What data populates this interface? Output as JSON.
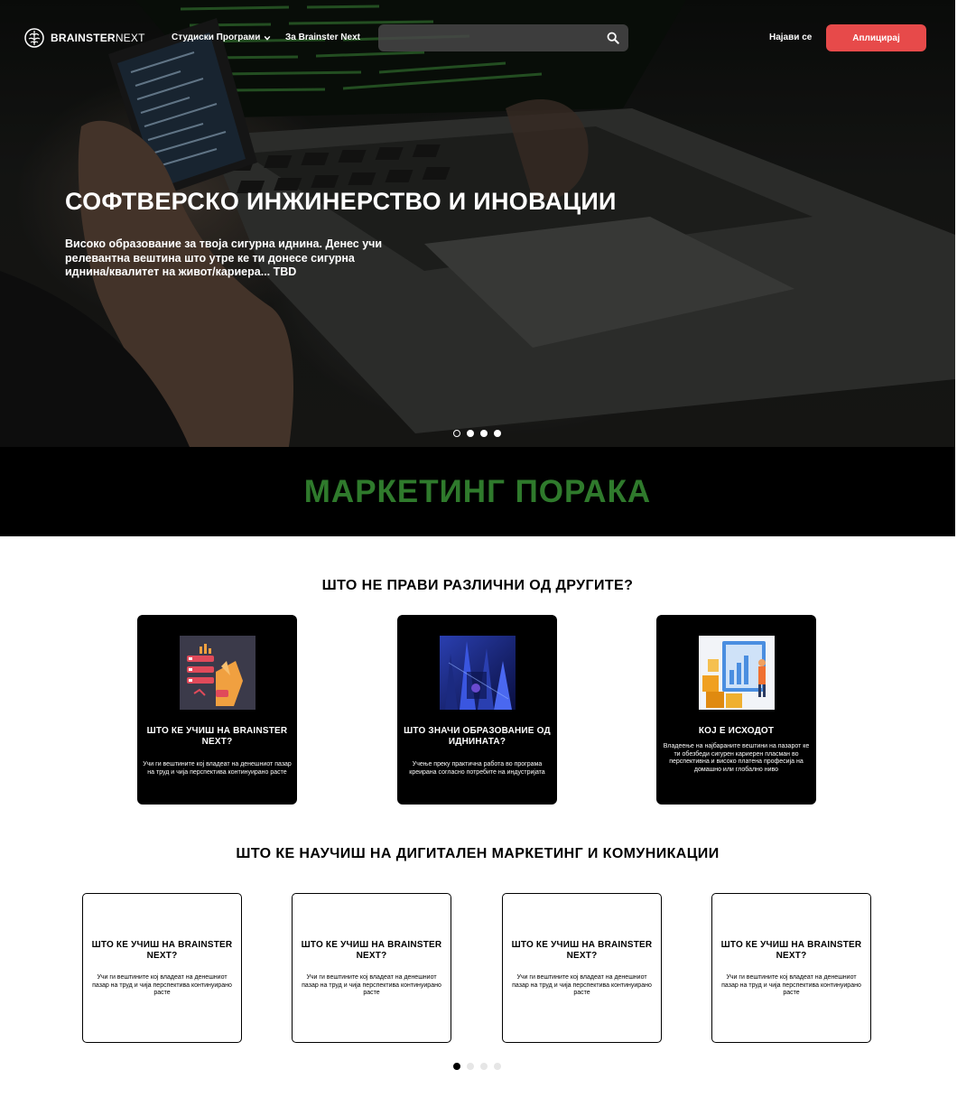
{
  "brand": {
    "name_bold": "BRAINSTER",
    "name_thin": "NEXT"
  },
  "nav": {
    "programs": "Студиски Програми",
    "about": "За Brainster Next",
    "search_placeholder": "",
    "login": "Најави се",
    "apply": "Аплицирај"
  },
  "hero": {
    "title": "СОФТВЕРСКО ИНЖИНЕРСТВО И ИНОВАЦИИ",
    "subtitle": "Високо образование за твоја сигурна иднина. Денес учи релевантна вештина што утре ке ти донесе сигурна иднина/квалитет на живот/кариера... TBD",
    "slides_total": 4,
    "active_slide": 1
  },
  "banner": {
    "text": "МАРКЕТИНГ ПОРАКА",
    "color": "#2f7a2c"
  },
  "differences": {
    "title": "ШТО НЕ ПРАВИ РАЗЛИЧНИ ОД ДРУГИТЕ?",
    "cards": [
      {
        "title": "ШТО КЕ УЧИШ НА BRAINSTER NEXT?",
        "text": "Учи ги вештините кој владеат на денешниот пазар на труд и чија перспектива континуирано расте",
        "icon": "learning-illustration"
      },
      {
        "title": "ШТО ЗНАЧИ ОБРАЗОВАНИЕ ОД ИДНИНАТА?",
        "text": "Учење преку практична работа во програма креирана согласно потребите на индустријата",
        "icon": "future-city-illustration"
      },
      {
        "title": "КОЈ Е ИСХОДОТ",
        "text": "Владеење на најбараните вештини на пазарот ке ти обезбеди сигурен кариерен пласман во перспективна и високо платена професија на домашно или глобално ниво",
        "icon": "outcome-illustration"
      }
    ]
  },
  "learn": {
    "title": "ШТО КЕ НАУЧИШ НА ДИГИТАЛЕН МАРКЕТИНГ И КОМУНИКАЦИИ",
    "cards": [
      {
        "title": "ШТО КЕ УЧИШ НА BRAINSTER NEXT?",
        "text": "Учи ги вештините кој владеат на денешниот пазар на труд и чија перспектива континуирано расте"
      },
      {
        "title": "ШТО КЕ УЧИШ НА BRAINSTER NEXT?",
        "text": "Учи ги вештините кој владеат на денешниот пазар на труд и чија перспектива континуирано расте"
      },
      {
        "title": "ШТО КЕ УЧИШ НА BRAINSTER NEXT?",
        "text": "Учи ги вештините кој владеат на денешниот пазар на труд и чија перспектива континуирано расте"
      },
      {
        "title": "ШТО КЕ УЧИШ НА BRAINSTER NEXT?",
        "text": "Учи ги вештините кој владеат на денешниот пазар на труд и чија перспектива континуирано расте"
      }
    ],
    "slides_total": 4,
    "active_slide": 1
  },
  "colors": {
    "accent_red": "#e74a4a",
    "banner_green": "#2f7a2c",
    "card_dark": "#000000"
  }
}
